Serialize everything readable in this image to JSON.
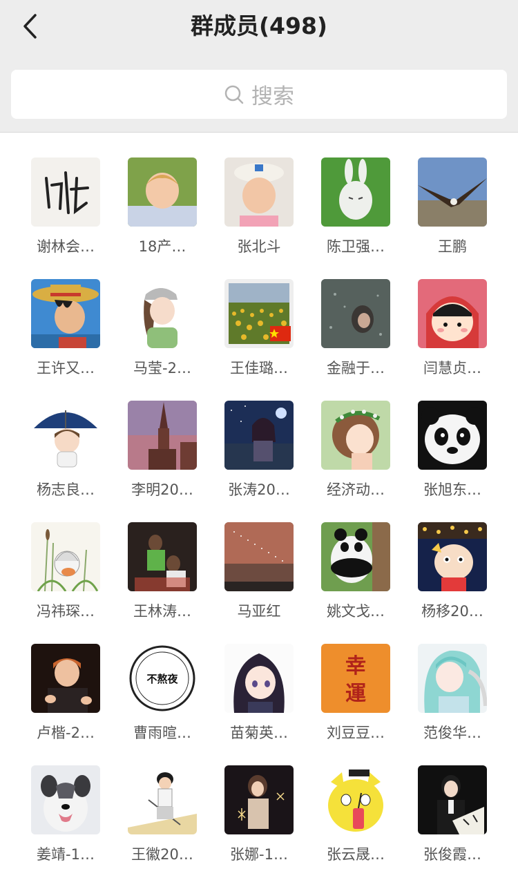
{
  "header": {
    "title": "群成员(498)"
  },
  "search": {
    "placeholder": "搜索"
  },
  "members": [
    {
      "name": "谢林会…",
      "avatar": "calligraphy-avatar"
    },
    {
      "name": "18产…",
      "avatar": "blond-child-avatar"
    },
    {
      "name": "张北斗",
      "avatar": "child-with-hat-avatar"
    },
    {
      "name": "陈卫强…",
      "avatar": "white-rabbit-avatar"
    },
    {
      "name": "王鹏",
      "avatar": "eagle-avatar"
    },
    {
      "name": "王许又…",
      "avatar": "straw-hat-anime-avatar"
    },
    {
      "name": "马莹-2…",
      "avatar": "girl-with-cap-avatar"
    },
    {
      "name": "王佳璐…",
      "avatar": "sunflower-field-avatar"
    },
    {
      "name": "金融于…",
      "avatar": "rainy-window-avatar"
    },
    {
      "name": "闫慧贞…",
      "avatar": "cartoon-girl-red-hood-avatar"
    },
    {
      "name": "杨志良…",
      "avatar": "boy-with-umbrella-avatar"
    },
    {
      "name": "李明20…",
      "avatar": "church-tower-avatar"
    },
    {
      "name": "张涛20…",
      "avatar": "anime-night-avatar"
    },
    {
      "name": "经济动…",
      "avatar": "girl-flower-crown-avatar"
    },
    {
      "name": "张旭东…",
      "avatar": "panda-face-avatar"
    },
    {
      "name": "冯祎琛…",
      "avatar": "sketch-girl-avatar"
    },
    {
      "name": "王林涛…",
      "avatar": "basketball-avatar"
    },
    {
      "name": "马亚红",
      "avatar": "sunset-sky-avatar"
    },
    {
      "name": "姚文戈…",
      "avatar": "panda-tree-avatar"
    },
    {
      "name": "杨移20…",
      "avatar": "cartoon-boy-avatar"
    },
    {
      "name": "卢楷-2…",
      "avatar": "redhead-man-avatar"
    },
    {
      "name": "曹雨暄…",
      "avatar": "text-badge-avatar",
      "badge_text": "不熬夜"
    },
    {
      "name": "苗菊英…",
      "avatar": "anime-dark-hair-girl-avatar"
    },
    {
      "name": "刘豆豆…",
      "avatar": "lucky-characters-avatar",
      "badge_text": "幸運"
    },
    {
      "name": "范俊华…",
      "avatar": "anime-blue-hair-avatar"
    },
    {
      "name": "姜靖-1…",
      "avatar": "dog-avatar"
    },
    {
      "name": "王徽20…",
      "avatar": "baseball-cartoon-avatar"
    },
    {
      "name": "张娜-1…",
      "avatar": "girl-sparkler-avatar"
    },
    {
      "name": "张云晟…",
      "avatar": "yellow-cat-avatar"
    },
    {
      "name": "张俊霞…",
      "avatar": "man-with-fan-avatar"
    }
  ],
  "colors": {
    "header_bg": "#ededed",
    "title_text": "#222222",
    "name_text": "#555555",
    "placeholder": "#b3b3b3"
  }
}
